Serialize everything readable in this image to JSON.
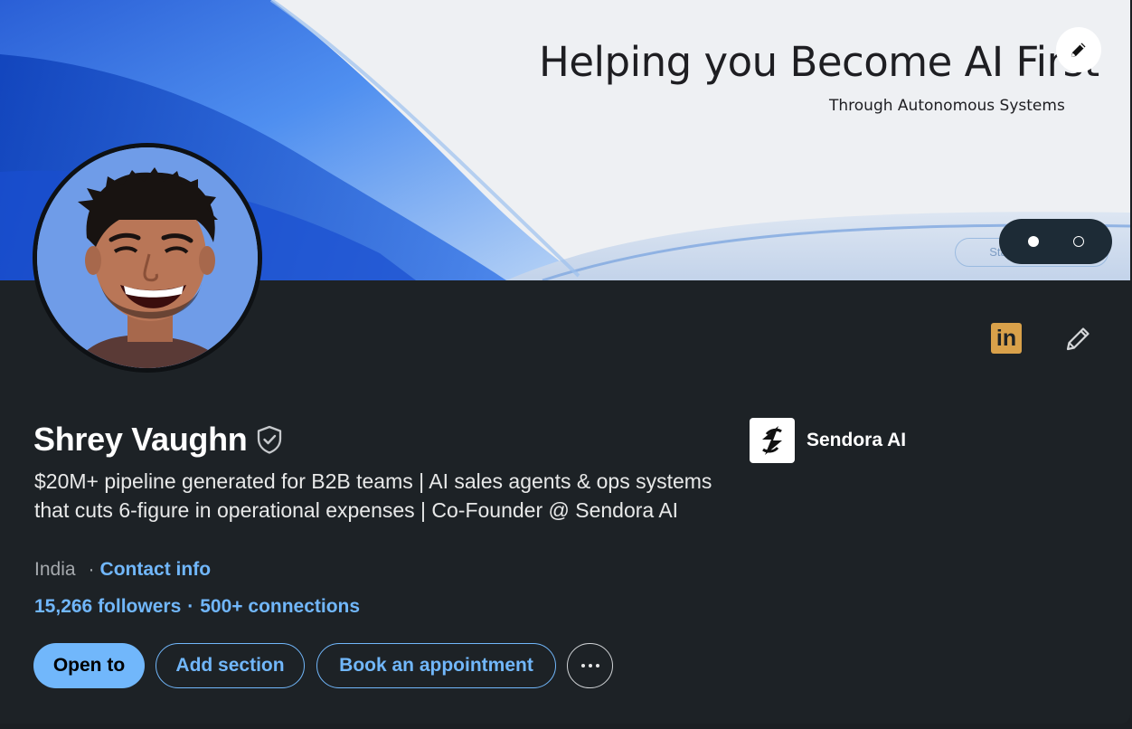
{
  "banner": {
    "headline": "Helping you Become AI First",
    "subheadline": "Through Autonomous Systems",
    "cta_label": "Start Today",
    "carousel": {
      "total": 2,
      "active": 1
    }
  },
  "profile": {
    "name": "Shrey Vaughn",
    "headline": "$20M+ pipeline generated for B2B teams |  AI sales agents & ops systems that cuts 6-figure in operational expenses | Co-Founder @ Sendora AI",
    "location": "India",
    "separator": "·",
    "contact_label": "Contact info",
    "followers": "15,266 followers",
    "connections": "500+ connections"
  },
  "company": {
    "name": "Sendora AI"
  },
  "actions": {
    "open_to": "Open to",
    "add_section": "Add section",
    "book_appointment": "Book an appointment"
  },
  "icons": {
    "linkedin": "in",
    "banner_edit": "pencil-icon",
    "profile_edit": "pencil-icon",
    "verified": "shield-check-icon",
    "more": "more-horizontal-icon"
  },
  "colors": {
    "background": "#1d2226",
    "accent": "#71b7fb",
    "linkedin_badge": "#d9a14a",
    "text_primary": "#ffffff",
    "text_secondary": "#a5a9ad"
  }
}
